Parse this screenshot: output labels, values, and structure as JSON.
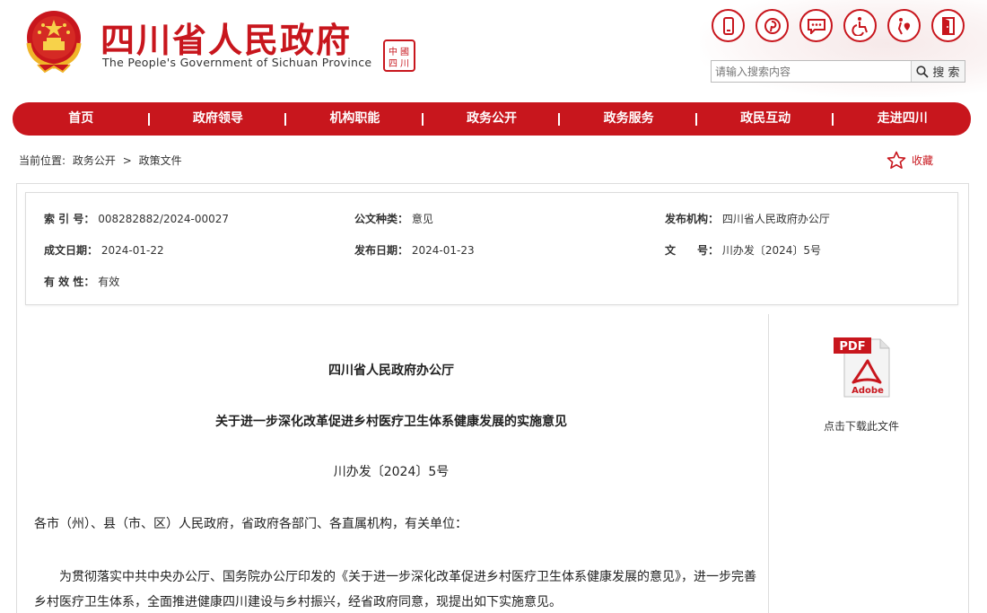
{
  "header": {
    "title": "四川省人民政府",
    "subtitle": "The People's Government of Sichuan Province",
    "seal_text": "中國四川",
    "tool_icons": [
      "mobile-icon",
      "pinterest-icon",
      "chat-icon",
      "wheelchair-icon",
      "elderly-care-icon",
      "exit-icon"
    ],
    "search": {
      "placeholder": "请输入搜索内容",
      "button_label": "搜 索"
    }
  },
  "nav": {
    "items": [
      {
        "label": "首页"
      },
      {
        "label": "政府领导"
      },
      {
        "label": "机构职能"
      },
      {
        "label": "政务公开"
      },
      {
        "label": "政务服务"
      },
      {
        "label": "政民互动"
      },
      {
        "label": "走进四川"
      }
    ]
  },
  "breadcrumb": {
    "prefix": "当前位置:",
    "level1": "政务公开",
    "separator": ">",
    "level2": "政策文件"
  },
  "favorite": {
    "label": "收藏"
  },
  "meta": {
    "index_label": "索 引 号：",
    "index_value": "008282882/2024-00027",
    "category_label": "公文种类：",
    "category_value": "意见",
    "publisher_label": "发布机构：",
    "publisher_value": "四川省人民政府办公厅",
    "created_label": "成文日期：",
    "created_value": "2024-01-22",
    "published_label": "发布日期：",
    "published_value": "2024-01-23",
    "docno_label": "文　　号：",
    "docno_value": "川办发〔2024〕5号",
    "validity_label": "有 效 性：",
    "validity_value": "有效"
  },
  "article": {
    "issuer": "四川省人民政府办公厅",
    "title": "关于进一步深化改革促进乡村医疗卫生体系健康发展的实施意见",
    "doc_number": "川办发〔2024〕5号",
    "salutation": "各市（州）、县（市、区）人民政府，省政府各部门、各直属机构，有关单位：",
    "paragraph1": "为贯彻落实中共中央办公厅、国务院办公厅印发的《关于进一步深化改革促进乡村医疗卫生体系健康发展的意见》，进一步完善乡村医疗卫生体系，全面推进健康四川建设与乡村振兴，经省政府同意，现提出如下实施意见。"
  },
  "sidebar": {
    "pdf_label": "PDF",
    "adobe_label": "Adobe",
    "download_label": "点击下载此文件"
  },
  "colors": {
    "brand_red": "#c8161d"
  }
}
